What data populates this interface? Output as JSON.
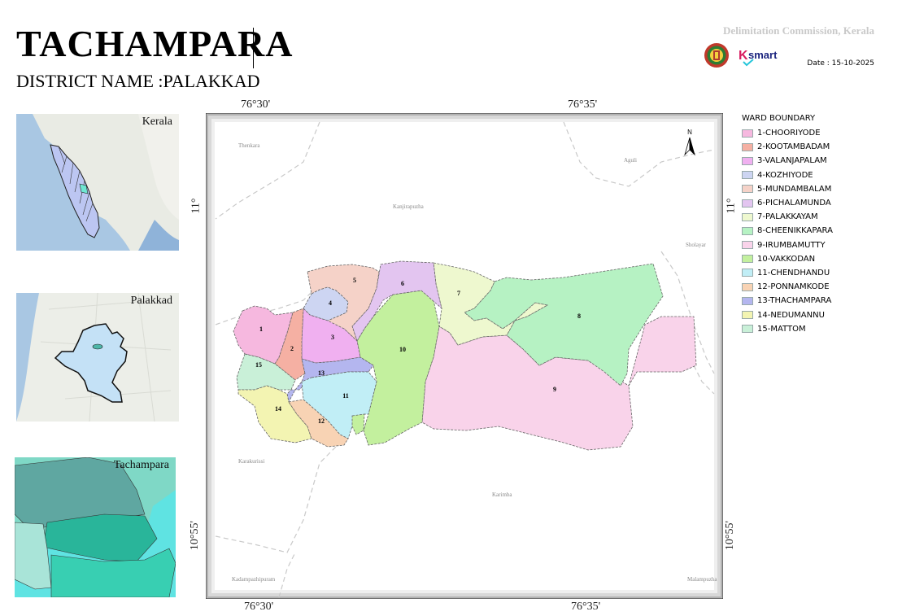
{
  "header": {
    "title": "TACHAMPARA",
    "subtitle": "DISTRICT NAME :PALAKKAD",
    "organization": "Delimitation Commission, Kerala",
    "date": "Date : 15-10-2025",
    "ksmart_logo_text": "K smart"
  },
  "insets": [
    {
      "label": "Kerala"
    },
    {
      "label": "Palakkad"
    },
    {
      "label": "Tachampara"
    }
  ],
  "coordinates": {
    "top_left": "76°30'",
    "top_right": "76°35'",
    "bottom_left": "76°30'",
    "bottom_right": "76°35'",
    "left_top": "11°",
    "left_bottom": "10°55'",
    "right_top": "11°",
    "right_bottom": "10°55'"
  },
  "place_names": [
    "Thenkara",
    "Aguli",
    "Kanjirapuzha",
    "Sholayar",
    "Karakurissi",
    "Karimba",
    "Kadampazhipuram",
    "Malampuzha"
  ],
  "north_arrow": "N",
  "legend": {
    "title": "WARD BOUNDARY",
    "items": [
      {
        "label": "1-CHOORIYODE",
        "color": "#f6b8df"
      },
      {
        "label": "2-KOOTAMBADAM",
        "color": "#f5b0a3"
      },
      {
        "label": "3-VALANJAPALAM",
        "color": "#f0b0f0"
      },
      {
        "label": "4-KOZHIYODE",
        "color": "#cdd5f2"
      },
      {
        "label": "5-MUNDAMBALAM",
        "color": "#f5d2c8"
      },
      {
        "label": "6-PICHALAMUNDA",
        "color": "#e3c5f0"
      },
      {
        "label": "7-PALAKKAYAM",
        "color": "#eef8cf"
      },
      {
        "label": "8-CHEENIKKAPARA",
        "color": "#b6f2c3"
      },
      {
        "label": "9-IRUMBAMUTTY",
        "color": "#f9d3ea"
      },
      {
        "label": "10-VAKKODAN",
        "color": "#c3f09e"
      },
      {
        "label": "11-CHENDHANDU",
        "color": "#c1eef6"
      },
      {
        "label": "12-PONNAMKODE",
        "color": "#f8d3b4"
      },
      {
        "label": "13-THACHAMPARA",
        "color": "#b4b6ef"
      },
      {
        "label": "14-NEDUMANNU",
        "color": "#f3f4b2"
      },
      {
        "label": "15-MATTOM",
        "color": "#c9f0d8"
      }
    ]
  },
  "ward_labels": [
    "1",
    "2",
    "3",
    "4",
    "5",
    "6",
    "7",
    "8",
    "9",
    "10",
    "11",
    "12",
    "13",
    "14",
    "15"
  ]
}
